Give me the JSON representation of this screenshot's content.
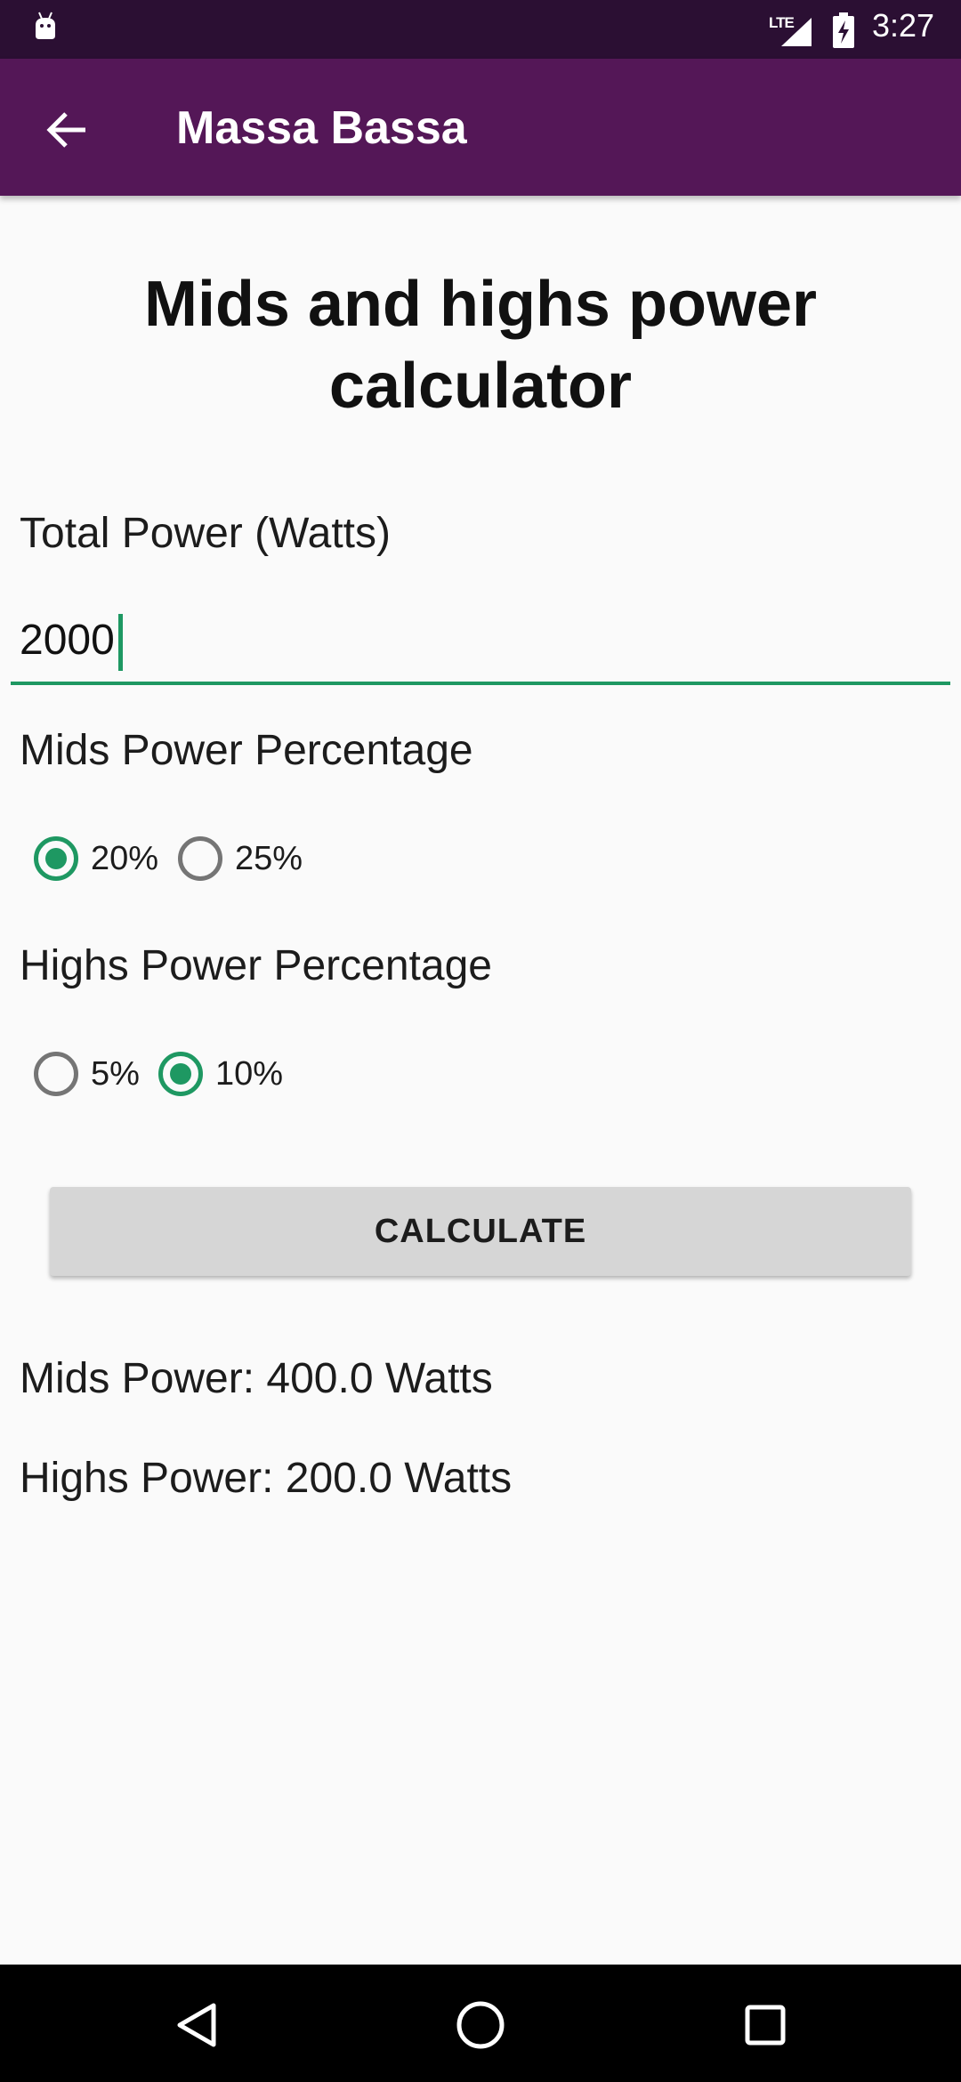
{
  "status_bar": {
    "network_label": "LTE",
    "time": "3:27",
    "icons": [
      "android-debug-icon",
      "signal-icon",
      "battery-charging-icon"
    ]
  },
  "app_bar": {
    "title": "Massa Bassa",
    "back_icon": "arrow-back-icon"
  },
  "page": {
    "title": "Mids and highs power calculator"
  },
  "form": {
    "total_power_label": "Total Power (Watts)",
    "total_power_value": "2000",
    "mids_label": "Mids Power Percentage",
    "mids_options": [
      {
        "label": "20%",
        "checked": true
      },
      {
        "label": "25%",
        "checked": false
      }
    ],
    "highs_label": "Highs Power Percentage",
    "highs_options": [
      {
        "label": "5%",
        "checked": false
      },
      {
        "label": "10%",
        "checked": true
      }
    ],
    "calculate_label": "CALCULATE"
  },
  "results": {
    "mids": "Mids Power: 400.0 Watts",
    "highs": "Highs Power: 200.0 Watts"
  },
  "nav_bar": {
    "icons": [
      "nav-back-icon",
      "nav-home-icon",
      "nav-recents-icon"
    ]
  },
  "colors": {
    "status_bar": "#2b0f33",
    "app_bar": "#541757",
    "accent": "#1e9862",
    "button": "#d6d6d6"
  }
}
